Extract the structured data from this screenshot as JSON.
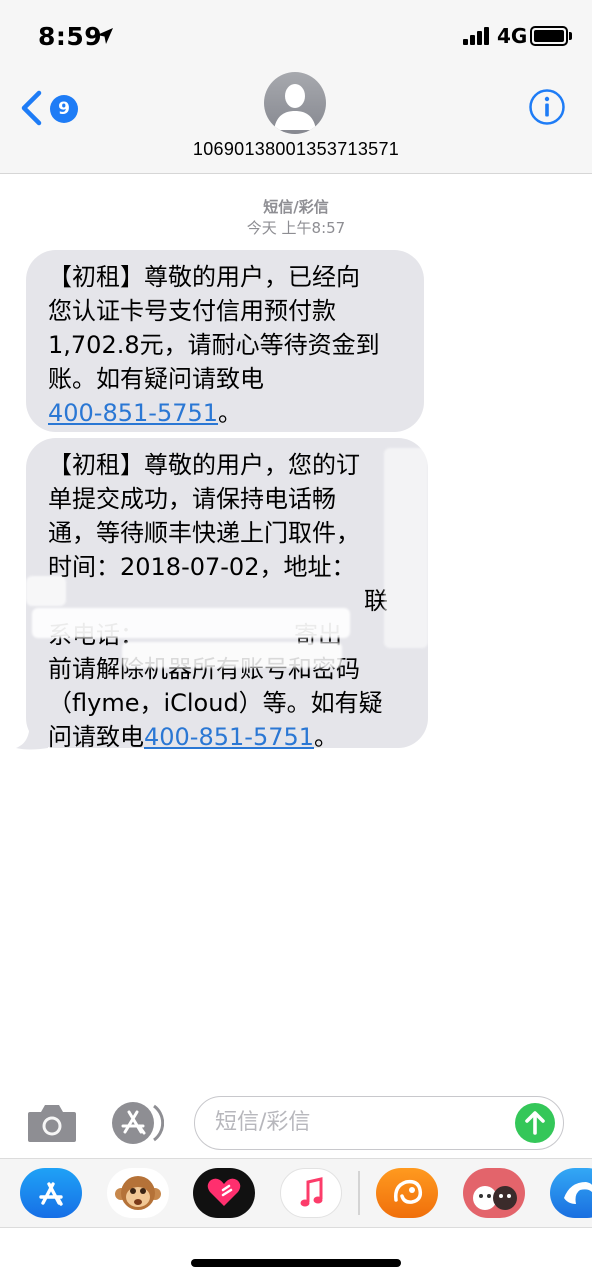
{
  "status_bar": {
    "time": "8:59",
    "network": "4G",
    "battery_level": 1.0
  },
  "header": {
    "back_badge": "9",
    "contact": "10690138001353713571"
  },
  "thread": {
    "service_label": "短信/彩信",
    "timestamp": "今天 上午8:57"
  },
  "messages": [
    {
      "lines": [
        "【初租】尊敬的用户，已经向",
        "您认证卡号支付信用预付款",
        "1,702.8元，请耐心等待资金到",
        "账。如有疑问请致电"
      ],
      "phone": "400-851-5751",
      "suffix": "。"
    },
    {
      "lines": [
        "【初租】尊敬的用户，您的订",
        "单提交成功，请保持电话畅",
        "通，等待顺丰快递上门取件，",
        "时间：2018-07-02，地址：",
        "联",
        "系电话：",
        "寄出",
        "前请解除机器所有账号和密码",
        "（flyme，iCloud）等。如有疑",
        "问请致电"
      ],
      "phone": "400-851-5751",
      "suffix": "。"
    }
  ],
  "compose": {
    "placeholder": "短信/彩信"
  },
  "colors": {
    "link": "#2a77d4",
    "bubble": "#e5e5ea",
    "badge": "#1e7cf6",
    "send": "#34c759"
  },
  "app_drawer": {
    "icons": [
      "app-store-icon",
      "animoji-monkey-icon",
      "digital-touch-heart-icon",
      "music-icon",
      "uc-browser-icon",
      "sticker-app-icon",
      "dolphin-app-icon"
    ]
  }
}
